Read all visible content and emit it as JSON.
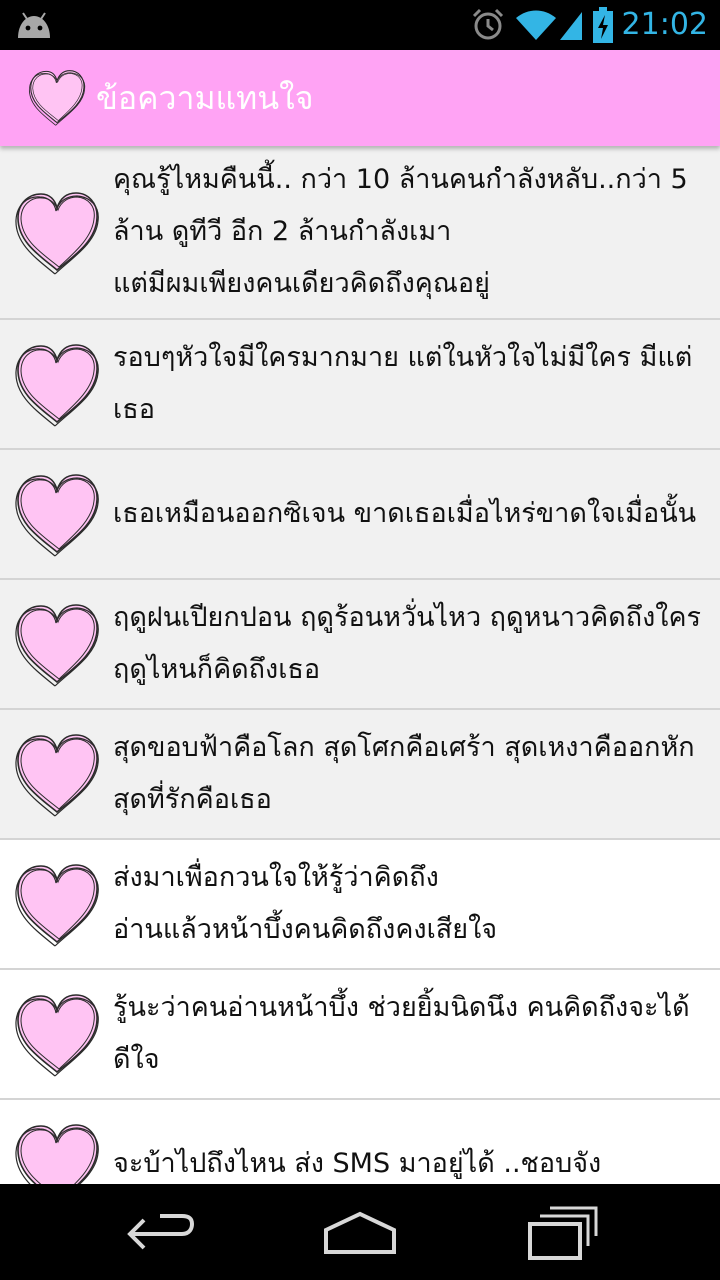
{
  "status_bar": {
    "time": "21:02",
    "icons": [
      "android-icon",
      "alarm-icon",
      "wifi-icon",
      "signal-icon",
      "battery-icon"
    ],
    "accent_color": "#33b5e5"
  },
  "action_bar": {
    "title": "ข้อความแทนใจ",
    "icon": "heart-icon",
    "background_color": "#ffa3f4"
  },
  "messages": [
    {
      "text": "คุณรู้ไหมคืนนี้.. กว่า 10 ล้านคนกำลังหลับ..กว่า 5 ล้าน ดูทีวี อีก 2 ล้านกำลังเมา\nแต่มีผมเพียงคนเดียวคิดถึงคุณอยู่"
    },
    {
      "text": "รอบๆหัวใจมีใครมากมาย แต่ในหัวใจไม่มีใคร มีแต่เธอ"
    },
    {
      "text": "เธอเหมือนออกซิเจน ขาดเธอเมื่อไหร่ขาดใจเมื่อนั้น"
    },
    {
      "text": "ฤดูฝนเปียกปอน ฤดูร้อนหวั่นไหว ฤดูหนาวคิดถึงใคร ฤดูไหนก็คิดถึงเธอ"
    },
    {
      "text": "สุดขอบฟ้าคือโลก สุดโศกคือเศร้า สุดเหงาคืออกหัก สุดที่รักคือเธอ"
    },
    {
      "text": "ส่งมาเพื่อกวนใจให้รู้ว่าคิดถึง\nอ่านแล้วหน้าบึ้งคนคิดถึงคงเสียใจ"
    },
    {
      "text": "รู้นะว่าคนอ่านหน้าบึ้ง ช่วยยิ้มนิดนึง คนคิดถึงจะได้ดีใจ"
    },
    {
      "text": "จะบ้าไปถึงไหน ส่ง SMS มาอยู่ได้ ..ชอบจัง"
    }
  ],
  "nav_bar": {
    "icons": [
      "back-icon",
      "home-icon",
      "recent-apps-icon"
    ]
  }
}
